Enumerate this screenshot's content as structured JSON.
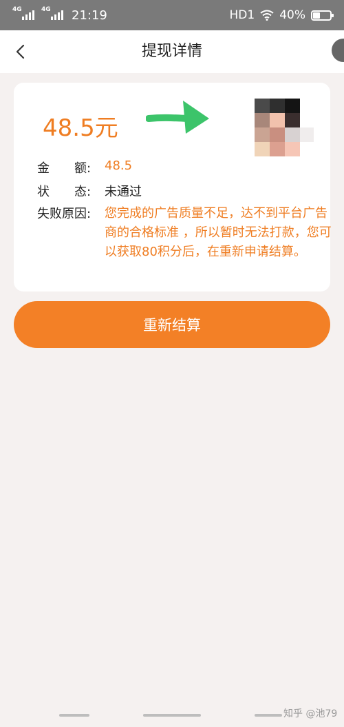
{
  "status_bar": {
    "net1": "4G",
    "net2": "4G",
    "time": "21:19",
    "hd": "HD1",
    "battery": "40%",
    "battery_level": 0.4
  },
  "nav": {
    "back_icon": "chevron-left-icon",
    "title": "提现详情"
  },
  "card": {
    "amount_display": "48.5元",
    "amount_label": "金　　额:",
    "amount_value": "48.5",
    "status_label": "状　　态:",
    "status_value": "未通过",
    "reason_label": "失败原因:",
    "reason_value": "您完成的广告质量不足，达不到平台广告商的合格标准 ，所以暂时无法打款，您可以获取80积分后，在重新申请结算。"
  },
  "button": {
    "label": "重新结算"
  },
  "watermark": "知乎 @池79",
  "colors": {
    "accent": "#ef7d22",
    "button": "#f38026",
    "arrow": "#3cc46a"
  }
}
